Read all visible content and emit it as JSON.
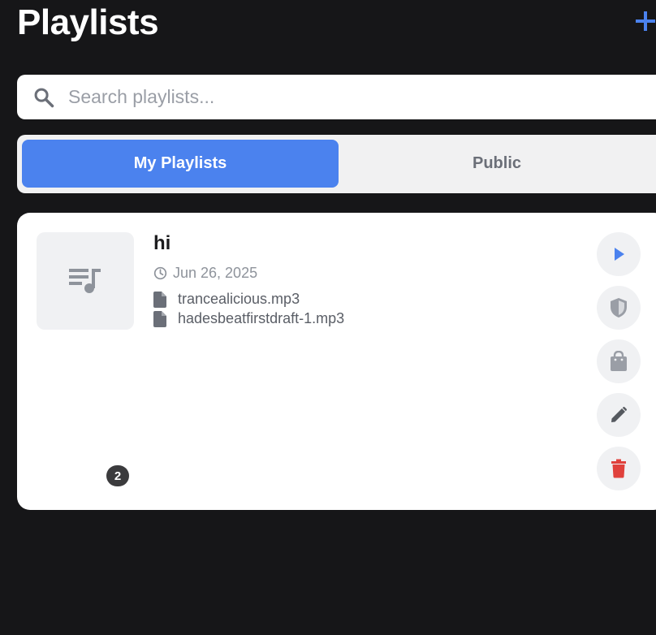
{
  "header": {
    "title": "Playlists",
    "add_icon": "plus-icon"
  },
  "search": {
    "placeholder": "Search playlists...",
    "value": "",
    "icon": "search-icon"
  },
  "tabs": [
    {
      "label": "My Playlists",
      "active": true
    },
    {
      "label": "Public",
      "active": false
    }
  ],
  "playlist": {
    "name": "hi",
    "date": "Jun 26, 2025",
    "track_count": "2",
    "thumbnail_icon": "playlist-music-icon",
    "tracks": [
      {
        "name": "trancealicious.mp3",
        "icon": "file-icon"
      },
      {
        "name": "hadesbeatfirstdraft-1.mp3",
        "icon": "file-icon"
      }
    ],
    "actions": [
      {
        "name": "play",
        "icon": "play-icon"
      },
      {
        "name": "privacy",
        "icon": "shield-icon"
      },
      {
        "name": "purchase",
        "icon": "shopping-bag-icon"
      },
      {
        "name": "edit",
        "icon": "pencil-icon"
      },
      {
        "name": "delete",
        "icon": "trash-icon"
      }
    ]
  },
  "colors": {
    "background": "#161618",
    "accent": "#4b82ee",
    "danger": "#e0413c",
    "icon_gray": "#9a9ea6"
  }
}
